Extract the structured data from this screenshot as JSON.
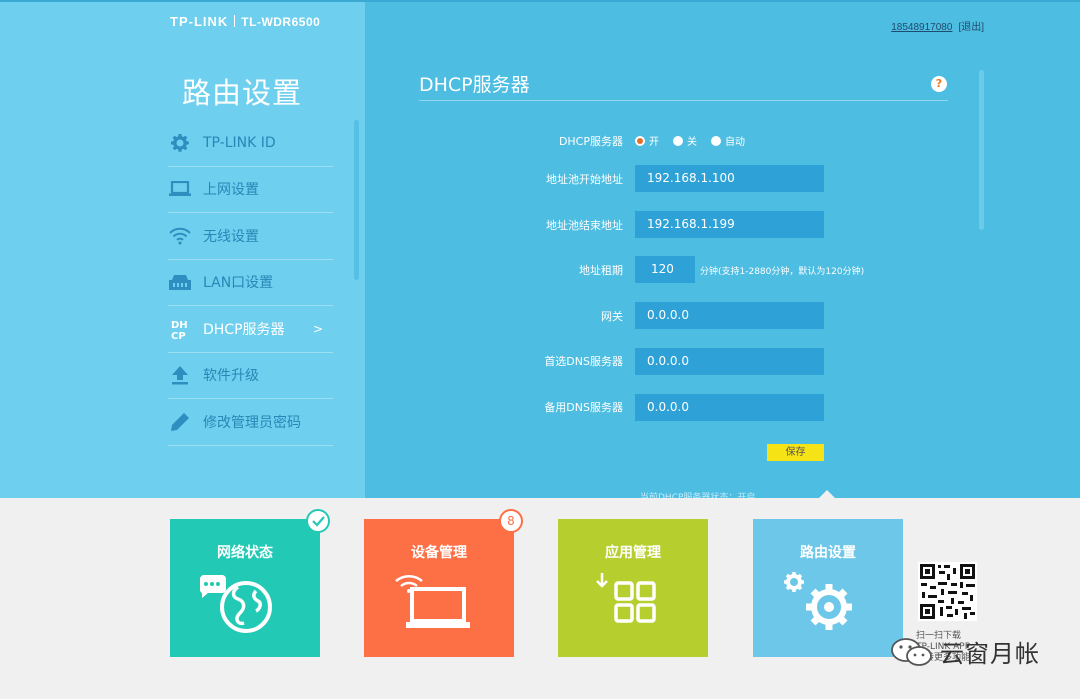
{
  "header": {
    "brand": "TP-LINK",
    "model": "TL-WDR6500",
    "phone": "18548917080",
    "logout": "[退出]"
  },
  "sidebar": {
    "title": "路由设置",
    "items": [
      {
        "label": "TP-LINK ID",
        "icon": "gear-icon"
      },
      {
        "label": "上网设置",
        "icon": "laptop-icon"
      },
      {
        "label": "无线设置",
        "icon": "wifi-icon"
      },
      {
        "label": "LAN口设置",
        "icon": "lan-port-icon"
      },
      {
        "label": "DHCP服务器",
        "icon": "dhcp-icon",
        "arrow": ">"
      },
      {
        "label": "软件升级",
        "icon": "upload-icon"
      },
      {
        "label": "修改管理员密码",
        "icon": "pencil-icon"
      }
    ]
  },
  "main": {
    "title": "DHCP服务器",
    "help": "?",
    "form": {
      "dhcp_label": "DHCP服务器",
      "radio_on": "开",
      "radio_off": "关",
      "radio_auto": "自动",
      "pool_start_label": "地址池开始地址",
      "pool_start_value": "192.168.1.100",
      "pool_end_label": "地址池结束地址",
      "pool_end_value": "192.168.1.199",
      "lease_label": "地址租期",
      "lease_value": "120",
      "lease_hint": "分钟(支持1-2880分钟，默认为120分钟)",
      "gateway_label": "网关",
      "gateway_value": "0.0.0.0",
      "dns1_label": "首选DNS服务器",
      "dns1_value": "0.0.0.0",
      "dns2_label": "备用DNS服务器",
      "dns2_value": "0.0.0.0",
      "save": "保存"
    },
    "status": "当前DHCP服务器状态：开启"
  },
  "tiles": [
    {
      "label": "网络状态",
      "color": "#22c9b4"
    },
    {
      "label": "设备管理",
      "color": "#fd6f45",
      "badge": "8"
    },
    {
      "label": "应用管理",
      "color": "#b6cf2f"
    },
    {
      "label": "路由设置",
      "color": "#6cc7e9"
    }
  ],
  "qr": {
    "caption": "扫一扫下载 TP-LINK APP 玩转更多功能"
  },
  "watermark": "云窗月帐"
}
